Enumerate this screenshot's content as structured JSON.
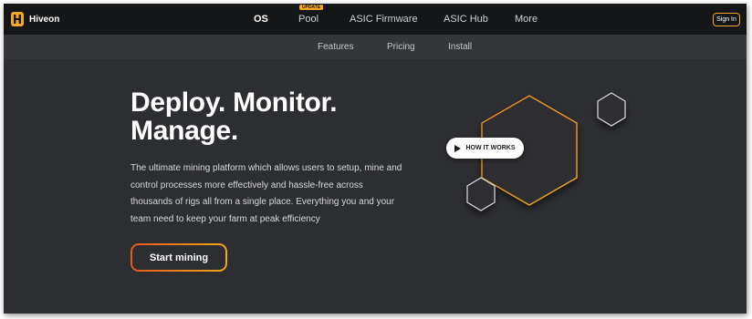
{
  "brand": {
    "name": "Hiveon",
    "accent": "#f5a623",
    "accent_start": "#e8571e"
  },
  "topnav": {
    "items": [
      {
        "label": "OS",
        "active": true
      },
      {
        "label": "Pool"
      },
      {
        "label": "ASIC Firmware"
      },
      {
        "label": "ASIC Hub"
      },
      {
        "label": "More"
      }
    ],
    "pool_badge": "UPDATE",
    "signin_label": "Sign In"
  },
  "subnav": {
    "items": [
      {
        "label": "Features"
      },
      {
        "label": "Pricing"
      },
      {
        "label": "Install"
      }
    ]
  },
  "hero": {
    "title_line1": "Deploy. Monitor.",
    "title_line2": "Manage.",
    "description": "The ultimate mining platform which allows users to setup, mine and control processes more effectively and hassle-free across thousands of rigs all from a single place. Everything you and your team need to keep your farm at peak efficiency",
    "cta_label": "Start mining",
    "video_label": "HOW IT WORKS",
    "video_icon": "play-icon"
  }
}
